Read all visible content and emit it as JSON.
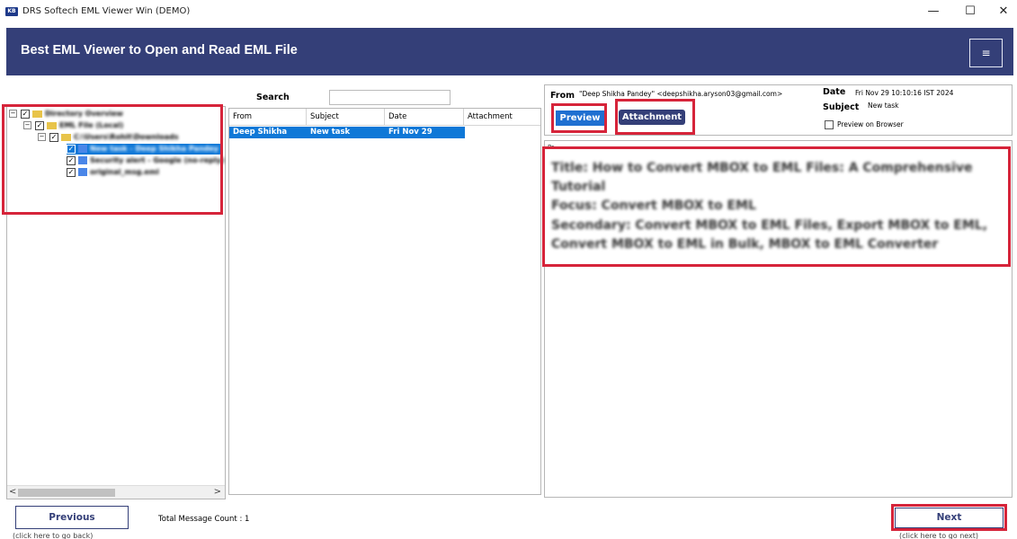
{
  "window": {
    "title": "DRS Softech EML Viewer Win (DEMO)",
    "icon_text": "KB",
    "minimize": "—",
    "maximize": "☐",
    "close": "✕"
  },
  "banner": {
    "title": "Best EML Viewer to Open and Read EML File",
    "menu_icon": "≡"
  },
  "tree": {
    "nodes": [
      {
        "label": "Directory Overview"
      },
      {
        "label": "EML File (Local)"
      },
      {
        "label": "C:\\Users\\Rohit\\Downloads"
      },
      {
        "label": "New task - Deep Shikha Pandey"
      },
      {
        "label": "Security alert - Google (no-reply)"
      },
      {
        "label": "original_msg.eml"
      }
    ],
    "scroll_left": "<",
    "scroll_right": ">"
  },
  "search": {
    "label": "Search",
    "value": ""
  },
  "list": {
    "columns": [
      "From",
      "Subject",
      "Date",
      "Attachment"
    ],
    "rows": [
      {
        "from": "Deep Shikha",
        "subject": "New task",
        "date": "Fri Nov 29"
      }
    ]
  },
  "preview": {
    "from_label": "From",
    "from_value": "\"Deep Shikha Pandey\" <deepshikha.aryson03@gmail.com>",
    "date_label": "Date",
    "date_value": "Fri Nov 29 10:10:16 IST 2024",
    "subject_label": "Subject",
    "subject_value": "New task",
    "preview_button": "Preview",
    "attachment_button": "Attachment",
    "browser_checkbox_label": "Preview on Browser"
  },
  "body": {
    "corner_mark": "Pr",
    "lines": [
      "Title: How to Convert MBOX to EML Files: A Comprehensive",
      "Tutorial",
      "Focus: Convert MBOX to EML",
      "Secondary: Convert MBOX to EML Files, Export MBOX to EML,",
      "Convert MBOX to EML in Bulk, MBOX to EML Converter"
    ]
  },
  "footer": {
    "previous_button": "Previous",
    "previous_hint": "(click here to go back)",
    "message_count": "Total Message Count : 1",
    "next_button": "Next",
    "next_hint": "(click here to go next)"
  },
  "colors": {
    "brand": "#343f78",
    "highlight": "#d6243a",
    "selection": "#0f78d7",
    "preview_button": "#1f6fd1",
    "attachment_button": "#343f78"
  }
}
